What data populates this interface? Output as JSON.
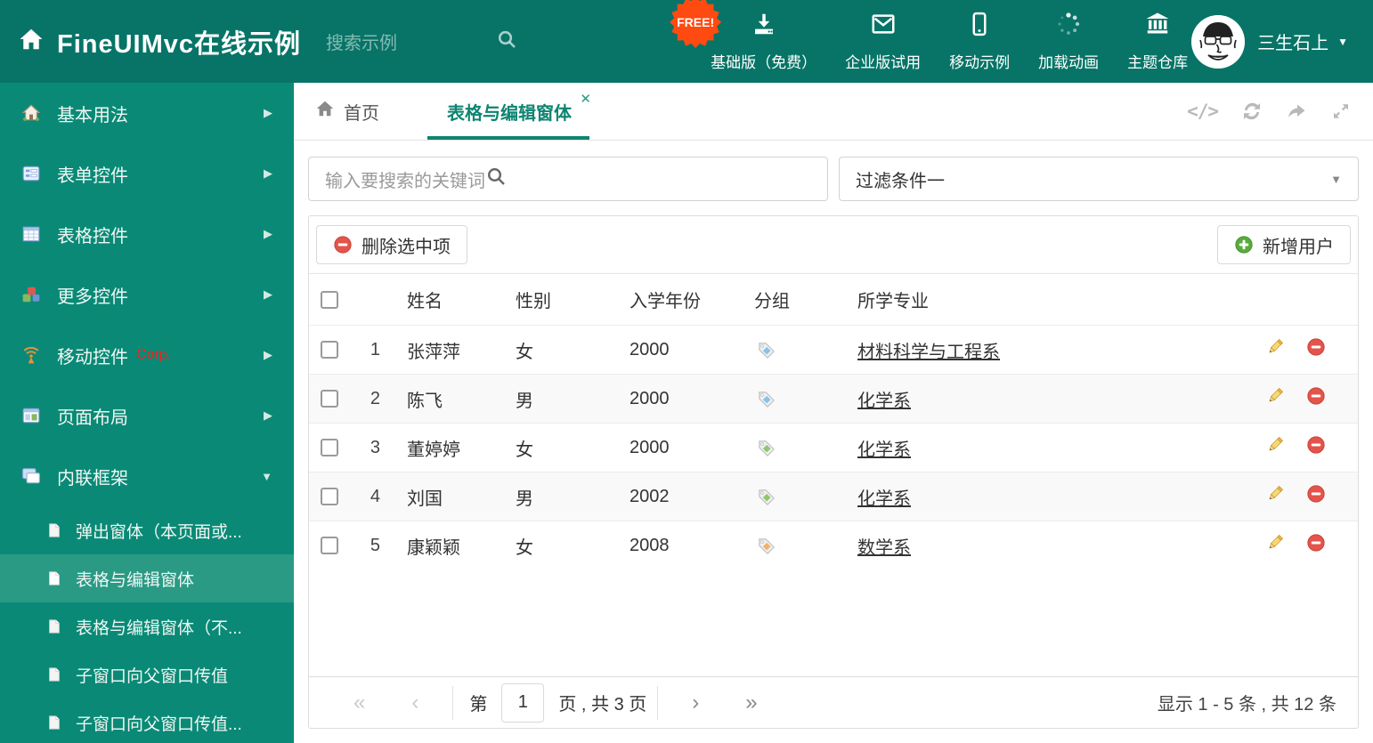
{
  "colors": {
    "header_bg": "#077467",
    "sidebar_bg": "#0a8a76",
    "sidebar_active_bg": "#2a9a85",
    "accent": "#0f8472",
    "free_badge_bg": "#ff4a11",
    "delete_red": "#e4544a",
    "add_green": "#5aab3c",
    "tag_blue": "#85c4ee",
    "tag_green": "#8dc86d",
    "tag_orange": "#f5b066"
  },
  "icons": {
    "arrow_right": "▶",
    "caret_down": "▼",
    "close": "✕",
    "code": "</>",
    "page_first": "«",
    "page_prev": "‹",
    "page_next": "›",
    "page_last": "»"
  },
  "header": {
    "title": "FineUIMvc在线示例",
    "search_placeholder": "搜索示例",
    "free_badge": "FREE!",
    "nav": [
      {
        "label": "基础版（免费）"
      },
      {
        "label": "企业版试用"
      },
      {
        "label": "移动示例"
      },
      {
        "label": "加载动画"
      },
      {
        "label": "主题仓库"
      }
    ],
    "username": "三生石上"
  },
  "sidebar": {
    "items": [
      {
        "label": "基本用法"
      },
      {
        "label": "表单控件"
      },
      {
        "label": "表格控件"
      },
      {
        "label": "更多控件"
      },
      {
        "label": "移动控件",
        "badge": "Corp."
      },
      {
        "label": "页面布局"
      },
      {
        "label": "内联框架"
      }
    ],
    "subitems": [
      {
        "label": "弹出窗体（本页面或..."
      },
      {
        "label": "表格与编辑窗体"
      },
      {
        "label": "表格与编辑窗体（不..."
      },
      {
        "label": "子窗口向父窗口传值"
      },
      {
        "label": "子窗口向父窗口传值..."
      }
    ]
  },
  "tabs": {
    "home": "首页",
    "active": "表格与编辑窗体"
  },
  "filters": {
    "search_placeholder": "输入要搜索的关键词",
    "filter_value": "过滤条件一"
  },
  "toolbar": {
    "delete_label": "删除选中项",
    "add_label": "新增用户"
  },
  "table": {
    "columns": {
      "name": "姓名",
      "gender": "性别",
      "year": "入学年份",
      "group": "分组",
      "major": "所学专业"
    },
    "rows": [
      {
        "index": "1",
        "name": "张萍萍",
        "gender": "女",
        "year": "2000",
        "tag_color": "#85c4ee",
        "major": "材料科学与工程系"
      },
      {
        "index": "2",
        "name": "陈飞",
        "gender": "男",
        "year": "2000",
        "tag_color": "#85c4ee",
        "major": "化学系"
      },
      {
        "index": "3",
        "name": "董婷婷",
        "gender": "女",
        "year": "2000",
        "tag_color": "#8dc86d",
        "major": "化学系"
      },
      {
        "index": "4",
        "name": "刘国",
        "gender": "男",
        "year": "2002",
        "tag_color": "#8dc86d",
        "major": "化学系"
      },
      {
        "index": "5",
        "name": "康颖颖",
        "gender": "女",
        "year": "2008",
        "tag_color": "#f5b066",
        "major": "数学系"
      }
    ]
  },
  "pagination": {
    "page_prefix": "第",
    "page_value": "1",
    "page_suffix": "页 , 共 3 页",
    "summary": "显示 1 - 5 条 , 共 12 条"
  }
}
